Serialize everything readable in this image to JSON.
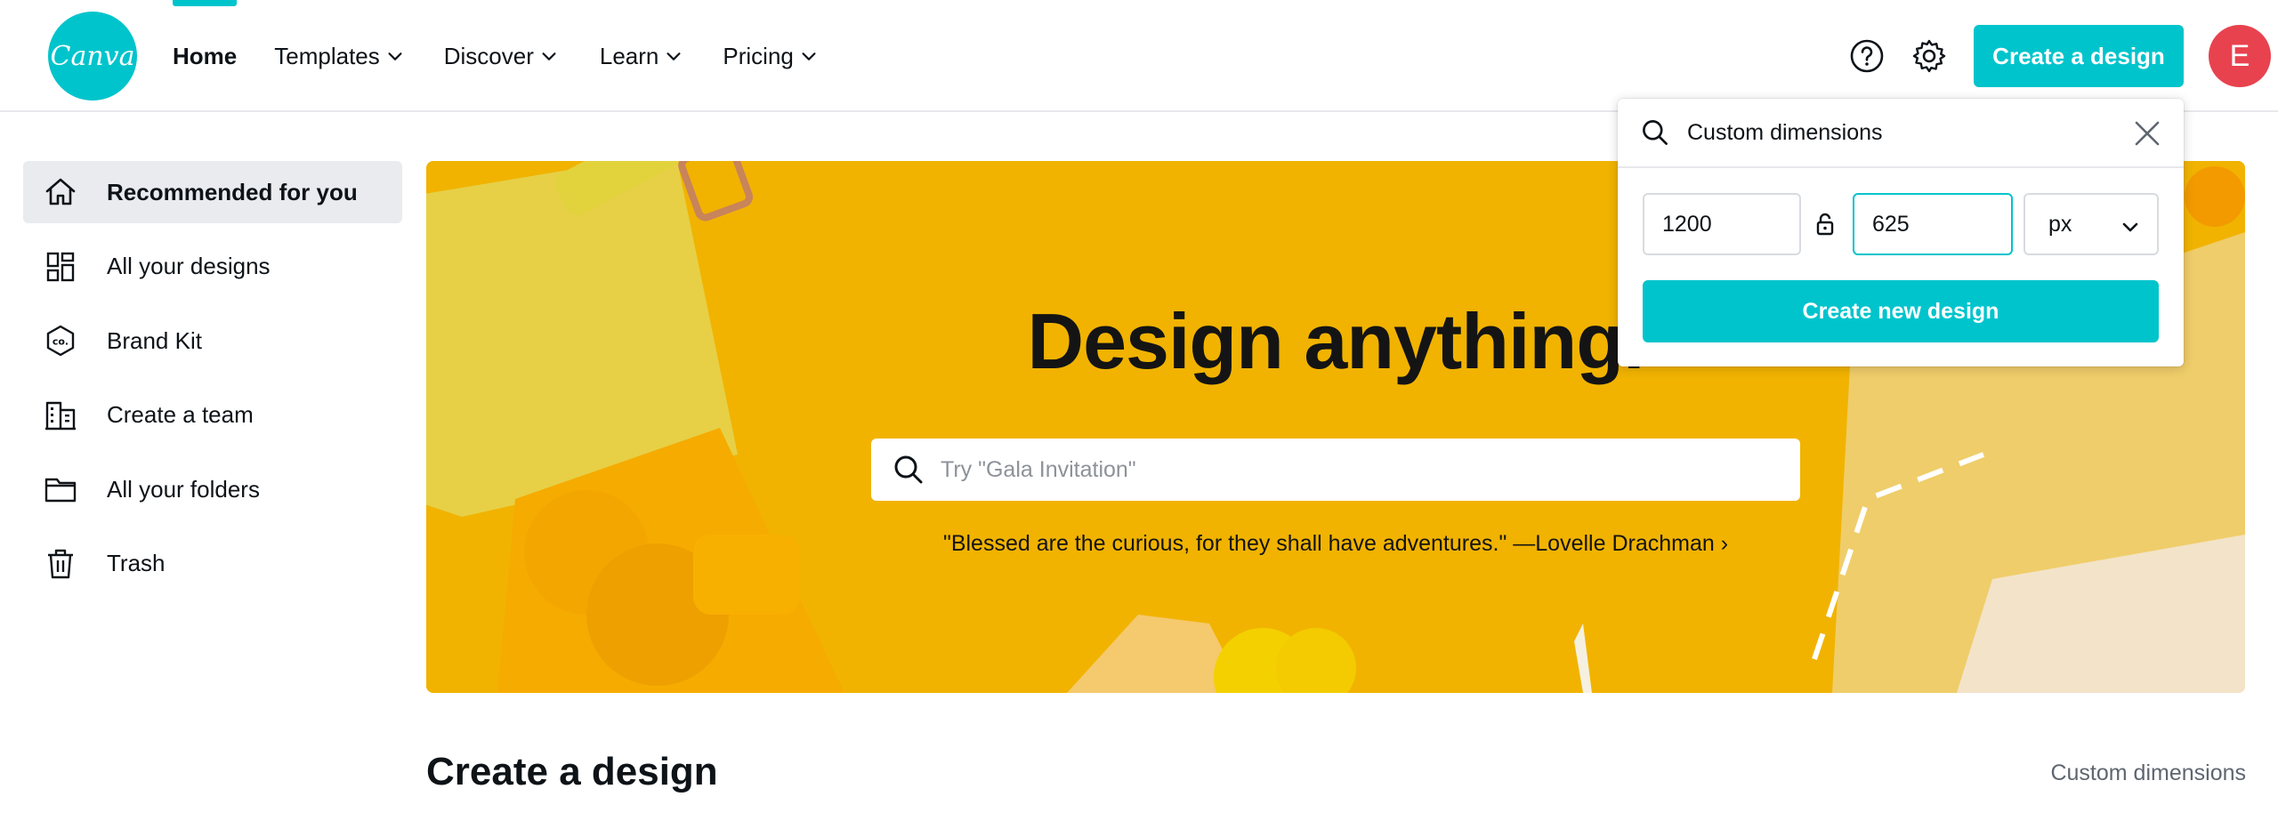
{
  "header": {
    "logo_text": "Canva",
    "nav": {
      "home": "Home",
      "templates": "Templates",
      "discover": "Discover",
      "learn": "Learn",
      "pricing": "Pricing"
    },
    "create_button": "Create a design",
    "avatar_initial": "E"
  },
  "sidebar": {
    "items": [
      {
        "label": "Recommended for you",
        "icon": "home-icon"
      },
      {
        "label": "All your designs",
        "icon": "grid-icon"
      },
      {
        "label": "Brand Kit",
        "icon": "brand-kit-icon"
      },
      {
        "label": "Create a team",
        "icon": "team-icon"
      },
      {
        "label": "All your folders",
        "icon": "folder-icon"
      },
      {
        "label": "Trash",
        "icon": "trash-icon"
      }
    ]
  },
  "hero": {
    "title": "Design anything.",
    "search_placeholder": "Try \"Gala Invitation\"",
    "quote": "\"Blessed are the curious, for they shall have adventures.\" —Lovelle Drachman ›"
  },
  "popover": {
    "search_value": "Custom dimensions",
    "width_value": "1200",
    "height_value": "625",
    "unit": "px",
    "create_button": "Create new design"
  },
  "section": {
    "title": "Create a design",
    "custom_link": "Custom dimensions"
  },
  "colors": {
    "accent": "#00c4cc",
    "avatar": "#e8424f",
    "hero_bg": "#f3b500"
  }
}
